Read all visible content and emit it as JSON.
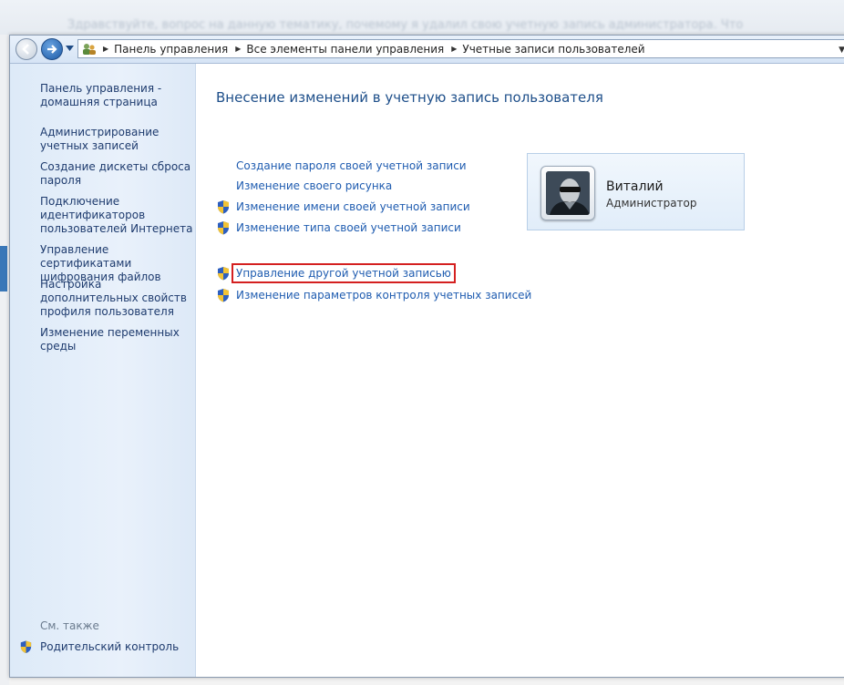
{
  "background": {
    "blurred_text": "Здравствуйте, вопрос на данную тематику, почемому я удалил свою учетную запись администратора. Что"
  },
  "toolbar": {
    "breadcrumbs": [
      "Панель управления",
      "Все элементы панели управления",
      "Учетные записи пользователей"
    ]
  },
  "sidebar": {
    "links": [
      "Панель управления - домашняя страница",
      "Администрирование учетных записей",
      "Создание дискеты сброса пароля",
      "Подключение идентификаторов пользователей Интернета",
      "Управление сертификатами шифрования файлов",
      "Настройка дополнительных свойств профиля пользователя",
      "Изменение переменных среды"
    ],
    "see_also_label": "См. также",
    "parental_control": "Родительский контроль"
  },
  "main": {
    "title": "Внесение изменений в учетную запись пользователя",
    "tasks": [
      {
        "label": "Создание пароля своей учетной записи",
        "shield": false
      },
      {
        "label": "Изменение своего рисунка",
        "shield": false
      },
      {
        "label": "Изменение имени своей учетной записи",
        "shield": true
      },
      {
        "label": "Изменение типа своей учетной записи",
        "shield": true
      },
      {
        "label": "Управление другой учетной записью",
        "shield": true,
        "highlighted": true
      },
      {
        "label": "Изменение параметров контроля учетных записей",
        "shield": true
      }
    ]
  },
  "user_card": {
    "name": "Виталий",
    "role": "Администратор"
  },
  "colors": {
    "link": "#1f5cb0",
    "title": "#1e4f8a",
    "highlight_border": "#d42020"
  }
}
